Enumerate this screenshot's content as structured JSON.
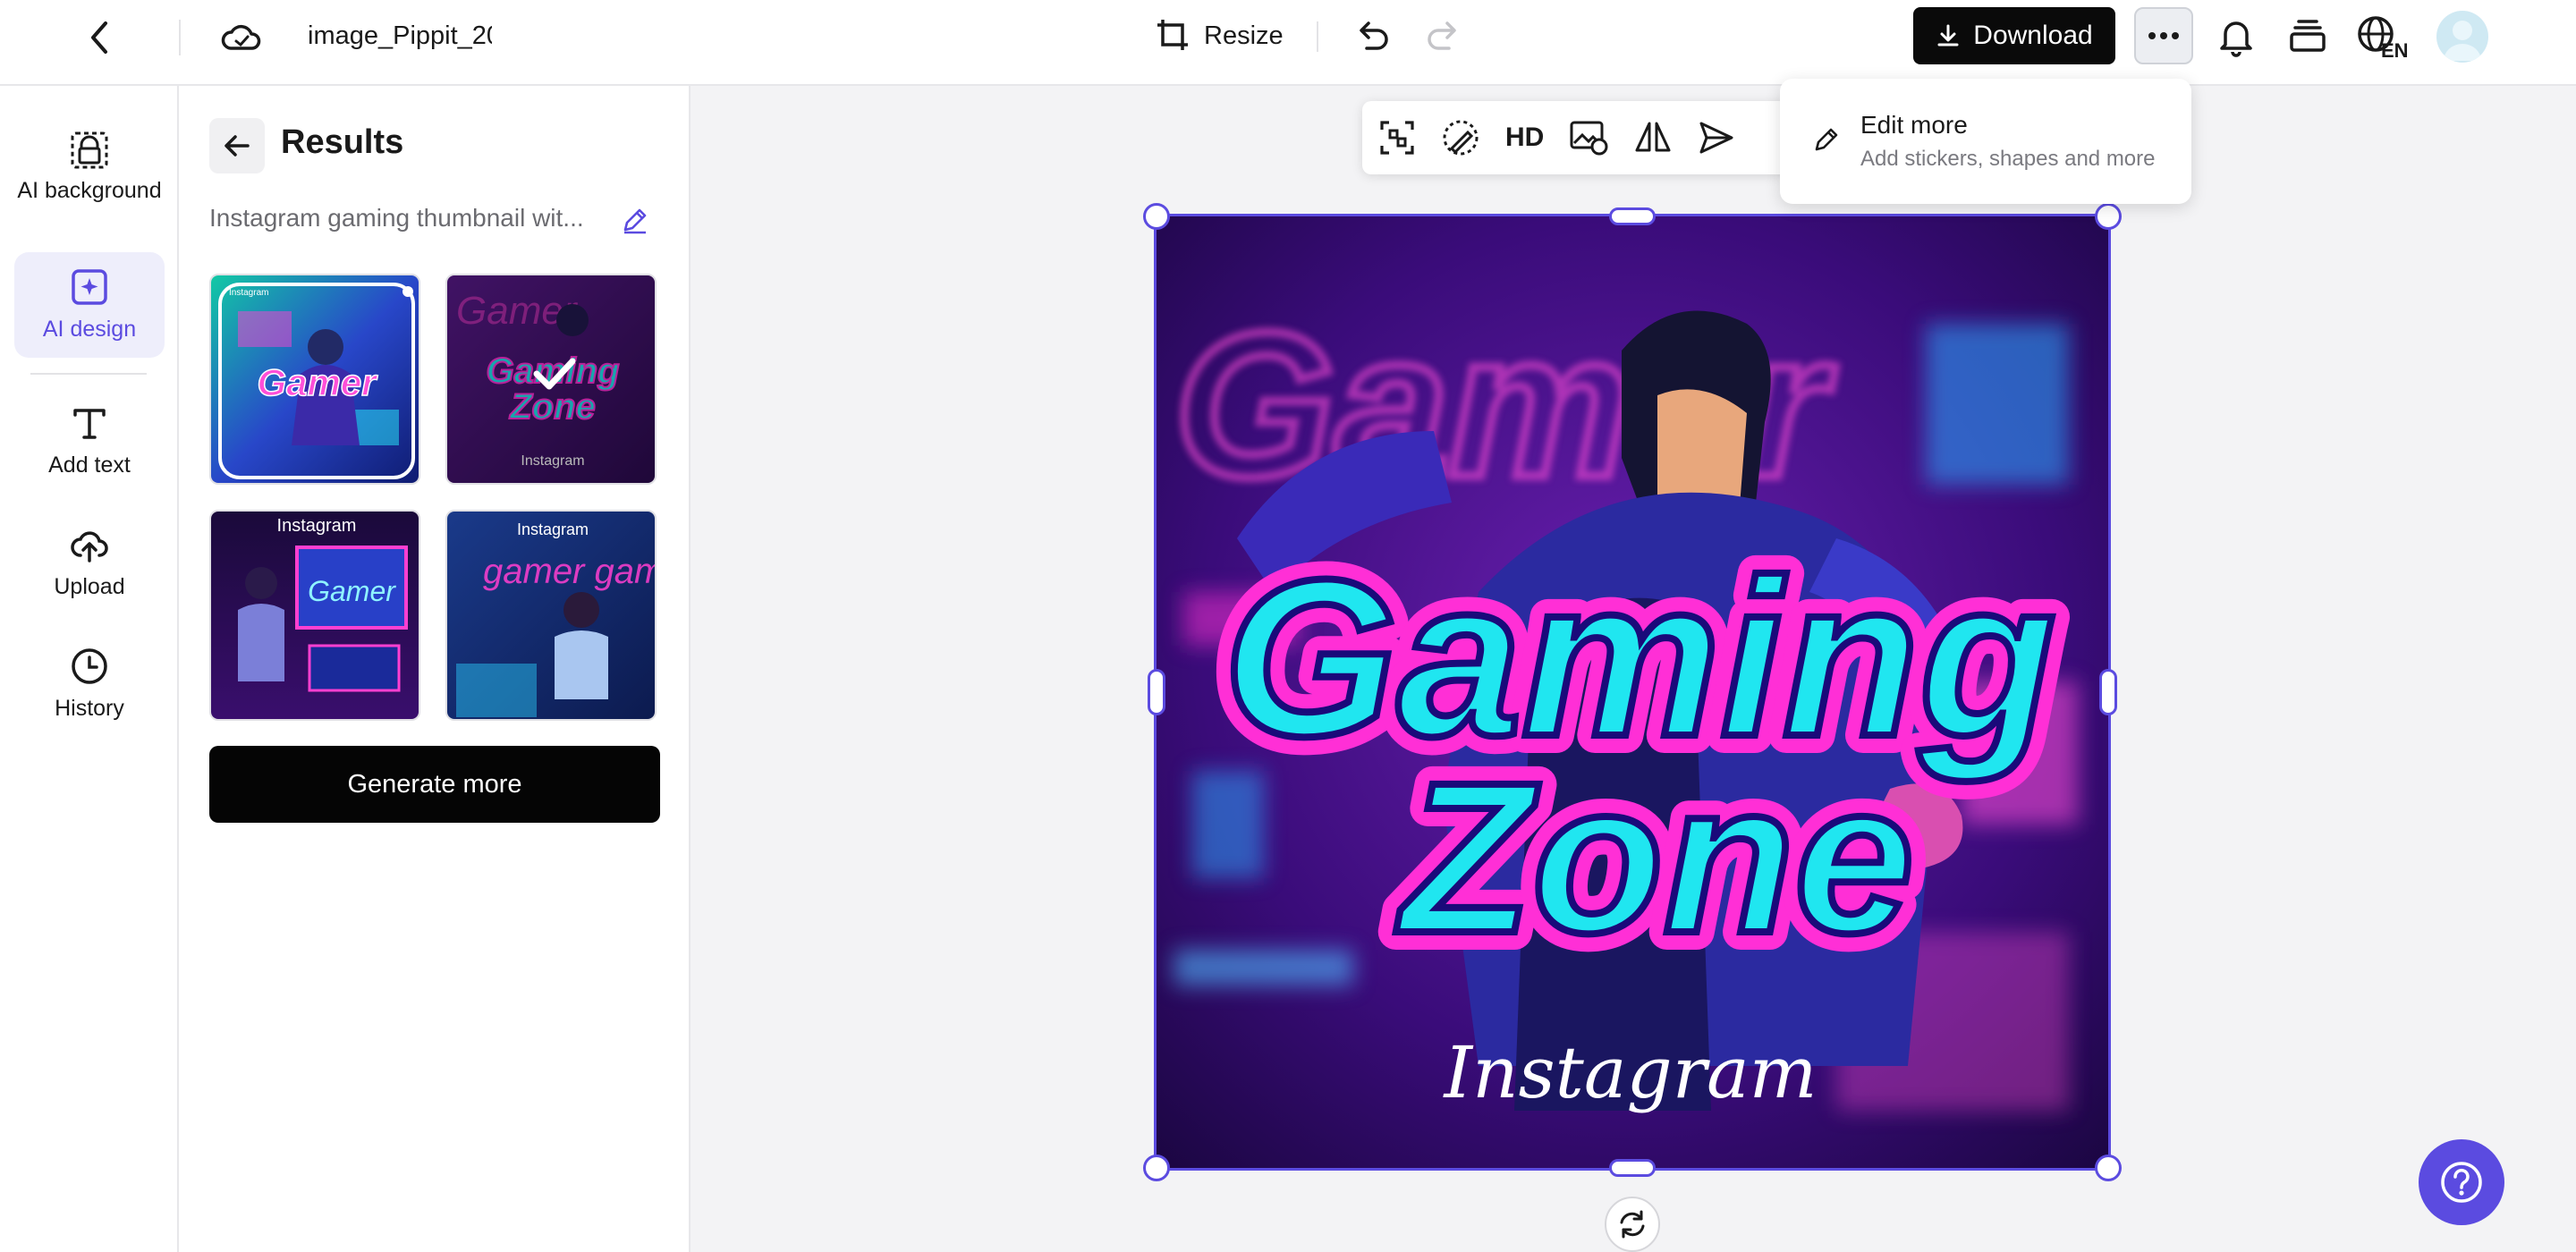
{
  "header": {
    "file_name": "image_Pippit_20",
    "resize_label": "Resize",
    "download_label": "Download",
    "language_code": "EN"
  },
  "rail": {
    "items": [
      {
        "label": "AI background",
        "icon": "ai-background-icon"
      },
      {
        "label": "AI design",
        "icon": "ai-design-icon",
        "active": true
      },
      {
        "label": "Add text",
        "icon": "text-icon"
      },
      {
        "label": "Upload",
        "icon": "upload-cloud-icon"
      },
      {
        "label": "History",
        "icon": "clock-icon"
      }
    ]
  },
  "results": {
    "title": "Results",
    "prompt": "Instagram gaming thumbnail wit...",
    "thumbnails": [
      {
        "title": "Gamer",
        "tag": "Instagram"
      },
      {
        "title": "Gaming Zone",
        "tag": "Instagram",
        "selected": true
      },
      {
        "title": "Gamer",
        "tag": "Instagram"
      },
      {
        "title": "gamer gam",
        "tag": "Instagram"
      }
    ],
    "generate_label": "Generate more"
  },
  "toolbar": {
    "hd_label": "HD"
  },
  "more_menu": {
    "title": "Edit more",
    "subtitle": "Add stickers, shapes and more"
  },
  "artwork": {
    "title_line1": "Gaming",
    "title_line2": "Zone",
    "background_word": "Gamer",
    "caption": "Instagram"
  },
  "colors": {
    "accent": "#5b4be0",
    "neon_cyan": "#20e6f0",
    "neon_magenta": "#ff2fd6",
    "deep_purple": "#2a0a5e"
  }
}
